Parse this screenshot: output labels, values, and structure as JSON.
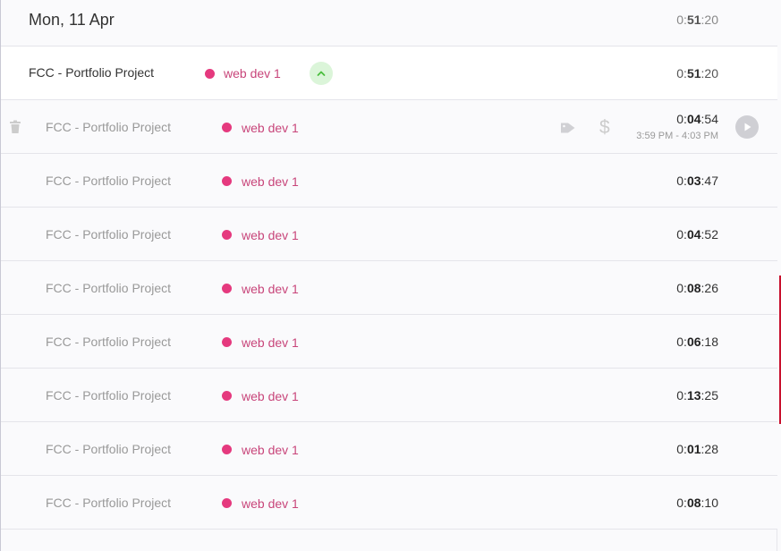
{
  "day": {
    "title": "Mon, 11 Apr",
    "total_prefix": "0:",
    "total_bold": "51",
    "total_suffix": ":20"
  },
  "group": {
    "description": "FCC - Portfolio Project",
    "project": "web dev 1",
    "project_color": "#e5397e",
    "duration_prefix": "0:",
    "duration_bold": "51",
    "duration_suffix": ":20",
    "expand_icon": "chevron-up-icon"
  },
  "entries": [
    {
      "description": "FCC - Portfolio Project",
      "project": "web dev 1",
      "d_pre": "0:",
      "d_bold": "04",
      "d_suf": ":54",
      "time_range": "3:59 PM - 4:03 PM"
    },
    {
      "description": "FCC - Portfolio Project",
      "project": "web dev 1",
      "d_pre": "0:",
      "d_bold": "03",
      "d_suf": ":47"
    },
    {
      "description": "FCC - Portfolio Project",
      "project": "web dev 1",
      "d_pre": "0:",
      "d_bold": "04",
      "d_suf": ":52"
    },
    {
      "description": "FCC - Portfolio Project",
      "project": "web dev 1",
      "d_pre": "0:",
      "d_bold": "08",
      "d_suf": ":26"
    },
    {
      "description": "FCC - Portfolio Project",
      "project": "web dev 1",
      "d_pre": "0:",
      "d_bold": "06",
      "d_suf": ":18"
    },
    {
      "description": "FCC - Portfolio Project",
      "project": "web dev 1",
      "d_pre": "0:",
      "d_bold": "13",
      "d_suf": ":25"
    },
    {
      "description": "FCC - Portfolio Project",
      "project": "web dev 1",
      "d_pre": "0:",
      "d_bold": "01",
      "d_suf": ":28"
    },
    {
      "description": "FCC - Portfolio Project",
      "project": "web dev 1",
      "d_pre": "0:",
      "d_bold": "08",
      "d_suf": ":10"
    }
  ],
  "icons": {
    "delete": "trash-icon",
    "tags": "tag-icon",
    "billable": "dollar-icon",
    "continue": "play-icon"
  }
}
